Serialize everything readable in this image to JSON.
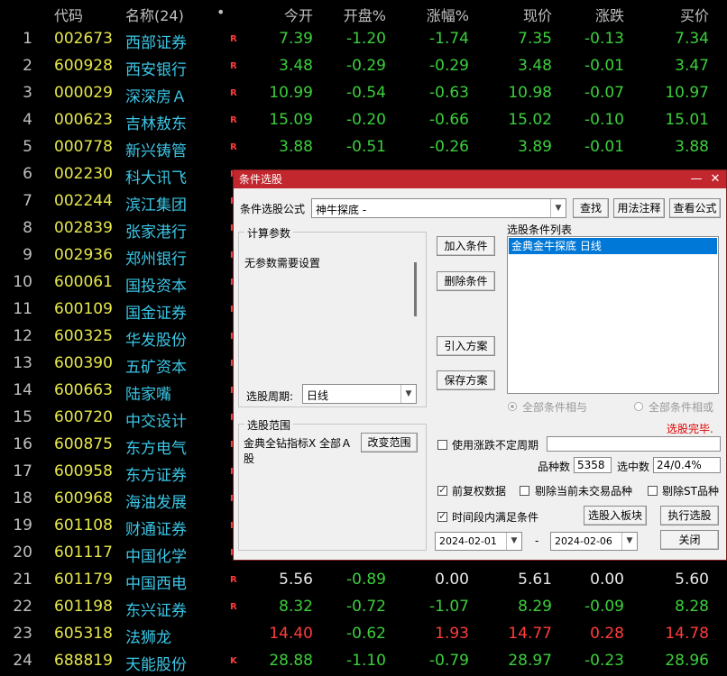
{
  "header": {
    "code": "代码",
    "name": "名称(24)",
    "dot": "•",
    "open": "今开",
    "open_pct": "开盘%",
    "change_pct": "涨幅%",
    "price": "现价",
    "change": "涨跌",
    "bid": "买价"
  },
  "stocks": [
    {
      "no": "1",
      "code": "002673",
      "name": "西部证券",
      "flag": "R",
      "open": "7.39",
      "open_pct": "-1.20",
      "change_pct": "-1.74",
      "price": "7.35",
      "change": "-0.13",
      "bid": "7.34"
    },
    {
      "no": "2",
      "code": "600928",
      "name": "西安银行",
      "flag": "R",
      "open": "3.48",
      "open_pct": "-0.29",
      "change_pct": "-0.29",
      "price": "3.48",
      "change": "-0.01",
      "bid": "3.47"
    },
    {
      "no": "3",
      "code": "000029",
      "name": "深深房Ａ",
      "flag": "R",
      "open": "10.99",
      "open_pct": "-0.54",
      "change_pct": "-0.63",
      "price": "10.98",
      "change": "-0.07",
      "bid": "10.97"
    },
    {
      "no": "4",
      "code": "000623",
      "name": "吉林敖东",
      "flag": "R",
      "open": "15.09",
      "open_pct": "-0.20",
      "change_pct": "-0.66",
      "price": "15.02",
      "change": "-0.10",
      "bid": "15.01"
    },
    {
      "no": "5",
      "code": "000778",
      "name": "新兴铸管",
      "flag": "R",
      "open": "3.88",
      "open_pct": "-0.51",
      "change_pct": "-0.26",
      "price": "3.89",
      "change": "-0.01",
      "bid": "3.88"
    },
    {
      "no": "6",
      "code": "002230",
      "name": "科大讯飞",
      "flag": "R",
      "open": "",
      "open_pct": "",
      "change_pct": "",
      "price": "",
      "change": "",
      "bid": ""
    },
    {
      "no": "7",
      "code": "002244",
      "name": "滨江集团",
      "flag": "R",
      "open": "",
      "open_pct": "",
      "change_pct": "",
      "price": "",
      "change": "",
      "bid": ""
    },
    {
      "no": "8",
      "code": "002839",
      "name": "张家港行",
      "flag": "R",
      "open": "",
      "open_pct": "",
      "change_pct": "",
      "price": "",
      "change": "",
      "bid": ""
    },
    {
      "no": "9",
      "code": "002936",
      "name": "郑州银行",
      "flag": "R",
      "open": "",
      "open_pct": "",
      "change_pct": "",
      "price": "",
      "change": "",
      "bid": ""
    },
    {
      "no": "10",
      "code": "600061",
      "name": "国投资本",
      "flag": "R",
      "open": "",
      "open_pct": "",
      "change_pct": "",
      "price": "",
      "change": "",
      "bid": ""
    },
    {
      "no": "11",
      "code": "600109",
      "name": "国金证券",
      "flag": "R",
      "open": "",
      "open_pct": "",
      "change_pct": "",
      "price": "",
      "change": "",
      "bid": ""
    },
    {
      "no": "12",
      "code": "600325",
      "name": "华发股份",
      "flag": "R",
      "open": "",
      "open_pct": "",
      "change_pct": "",
      "price": "",
      "change": "",
      "bid": ""
    },
    {
      "no": "13",
      "code": "600390",
      "name": "五矿资本",
      "flag": "R",
      "open": "",
      "open_pct": "",
      "change_pct": "",
      "price": "",
      "change": "",
      "bid": ""
    },
    {
      "no": "14",
      "code": "600663",
      "name": "陆家嘴",
      "flag": "R",
      "open": "",
      "open_pct": "",
      "change_pct": "",
      "price": "",
      "change": "",
      "bid": ""
    },
    {
      "no": "15",
      "code": "600720",
      "name": "中交设计",
      "flag": "R",
      "open": "",
      "open_pct": "",
      "change_pct": "",
      "price": "",
      "change": "",
      "bid": ""
    },
    {
      "no": "16",
      "code": "600875",
      "name": "东方电气",
      "flag": "R",
      "open": "",
      "open_pct": "",
      "change_pct": "",
      "price": "",
      "change": "",
      "bid": ""
    },
    {
      "no": "17",
      "code": "600958",
      "name": "东方证券",
      "flag": "R",
      "open": "",
      "open_pct": "",
      "change_pct": "",
      "price": "",
      "change": "",
      "bid": ""
    },
    {
      "no": "18",
      "code": "600968",
      "name": "海油发展",
      "flag": "R",
      "open": "",
      "open_pct": "",
      "change_pct": "",
      "price": "",
      "change": "",
      "bid": ""
    },
    {
      "no": "19",
      "code": "601108",
      "name": "财通证券",
      "flag": "R",
      "open": "",
      "open_pct": "",
      "change_pct": "",
      "price": "",
      "change": "",
      "bid": ""
    },
    {
      "no": "20",
      "code": "601117",
      "name": "中国化学",
      "flag": "R",
      "open": "",
      "open_pct": "",
      "change_pct": "",
      "price": "",
      "change": "",
      "bid": ""
    },
    {
      "no": "21",
      "code": "601179",
      "name": "中国西电",
      "flag": "R",
      "open": "5.56",
      "open_pct": "-0.89",
      "change_pct": "0.00",
      "price": "5.61",
      "change": "0.00",
      "bid": "5.60"
    },
    {
      "no": "22",
      "code": "601198",
      "name": "东兴证券",
      "flag": "R",
      "open": "8.32",
      "open_pct": "-0.72",
      "change_pct": "-1.07",
      "price": "8.29",
      "change": "-0.09",
      "bid": "8.28"
    },
    {
      "no": "23",
      "code": "605318",
      "name": "法狮龙",
      "flag": "",
      "open": "14.40",
      "open_pct": "-0.62",
      "change_pct": "1.93",
      "price": "14.77",
      "change": "0.28",
      "bid": "14.78"
    },
    {
      "no": "24",
      "code": "688819",
      "name": "天能股份",
      "flag": "K",
      "open": "28.88",
      "open_pct": "-1.10",
      "change_pct": "-0.79",
      "price": "28.97",
      "change": "-0.23",
      "bid": "28.96"
    }
  ],
  "colors": {
    "up": "#ff3c3c",
    "down": "#3ccf3c",
    "flat": "#e8e8e8",
    "code": "#e6e64c",
    "name": "#3cc6e6",
    "title_bar": "#c1272d"
  },
  "dialog": {
    "title": "条件选股",
    "minimize": "—",
    "close": "✕",
    "formula_label": "条件选股公式",
    "formula_value": "神牛探底  -",
    "find_btn": "查找",
    "usage_btn": "用法注释",
    "view_formula_btn": "查看公式",
    "calc_params_label": "计算参数",
    "no_params": "无参数需要设置",
    "period_label": "选股周期:",
    "period_value": "日线",
    "add_cond_btn": "加入条件",
    "del_cond_btn": "删除条件",
    "import_btn": "引入方案",
    "save_btn": "保存方案",
    "cond_list_label": "选股条件列表",
    "cond_items": [
      "金典金牛探底  日线"
    ],
    "radio_and": "全部条件相与",
    "radio_or": "全部条件相或",
    "status": "选股完毕.",
    "scope_label": "选股范围",
    "scope_value": "金典全钻指标X 全部Ａ股",
    "change_scope_btn": "改变范围",
    "use_range_period": "使用涨跌不定周期",
    "count_label": "品种数",
    "count_value": "5358",
    "selected_label": "选中数",
    "selected_value": "24/0.4%",
    "pre_adjust": "前复权数据",
    "exclude_untraded": "剔除当前未交易品种",
    "exclude_st": "剔除ST品种",
    "time_range": "时间段内满足条件",
    "date_from": "2024-02-01",
    "date_sep": "-",
    "date_to": "2024-02-06",
    "to_block_btn": "选股入板块",
    "run_btn": "执行选股",
    "close_btn": "关闭"
  }
}
